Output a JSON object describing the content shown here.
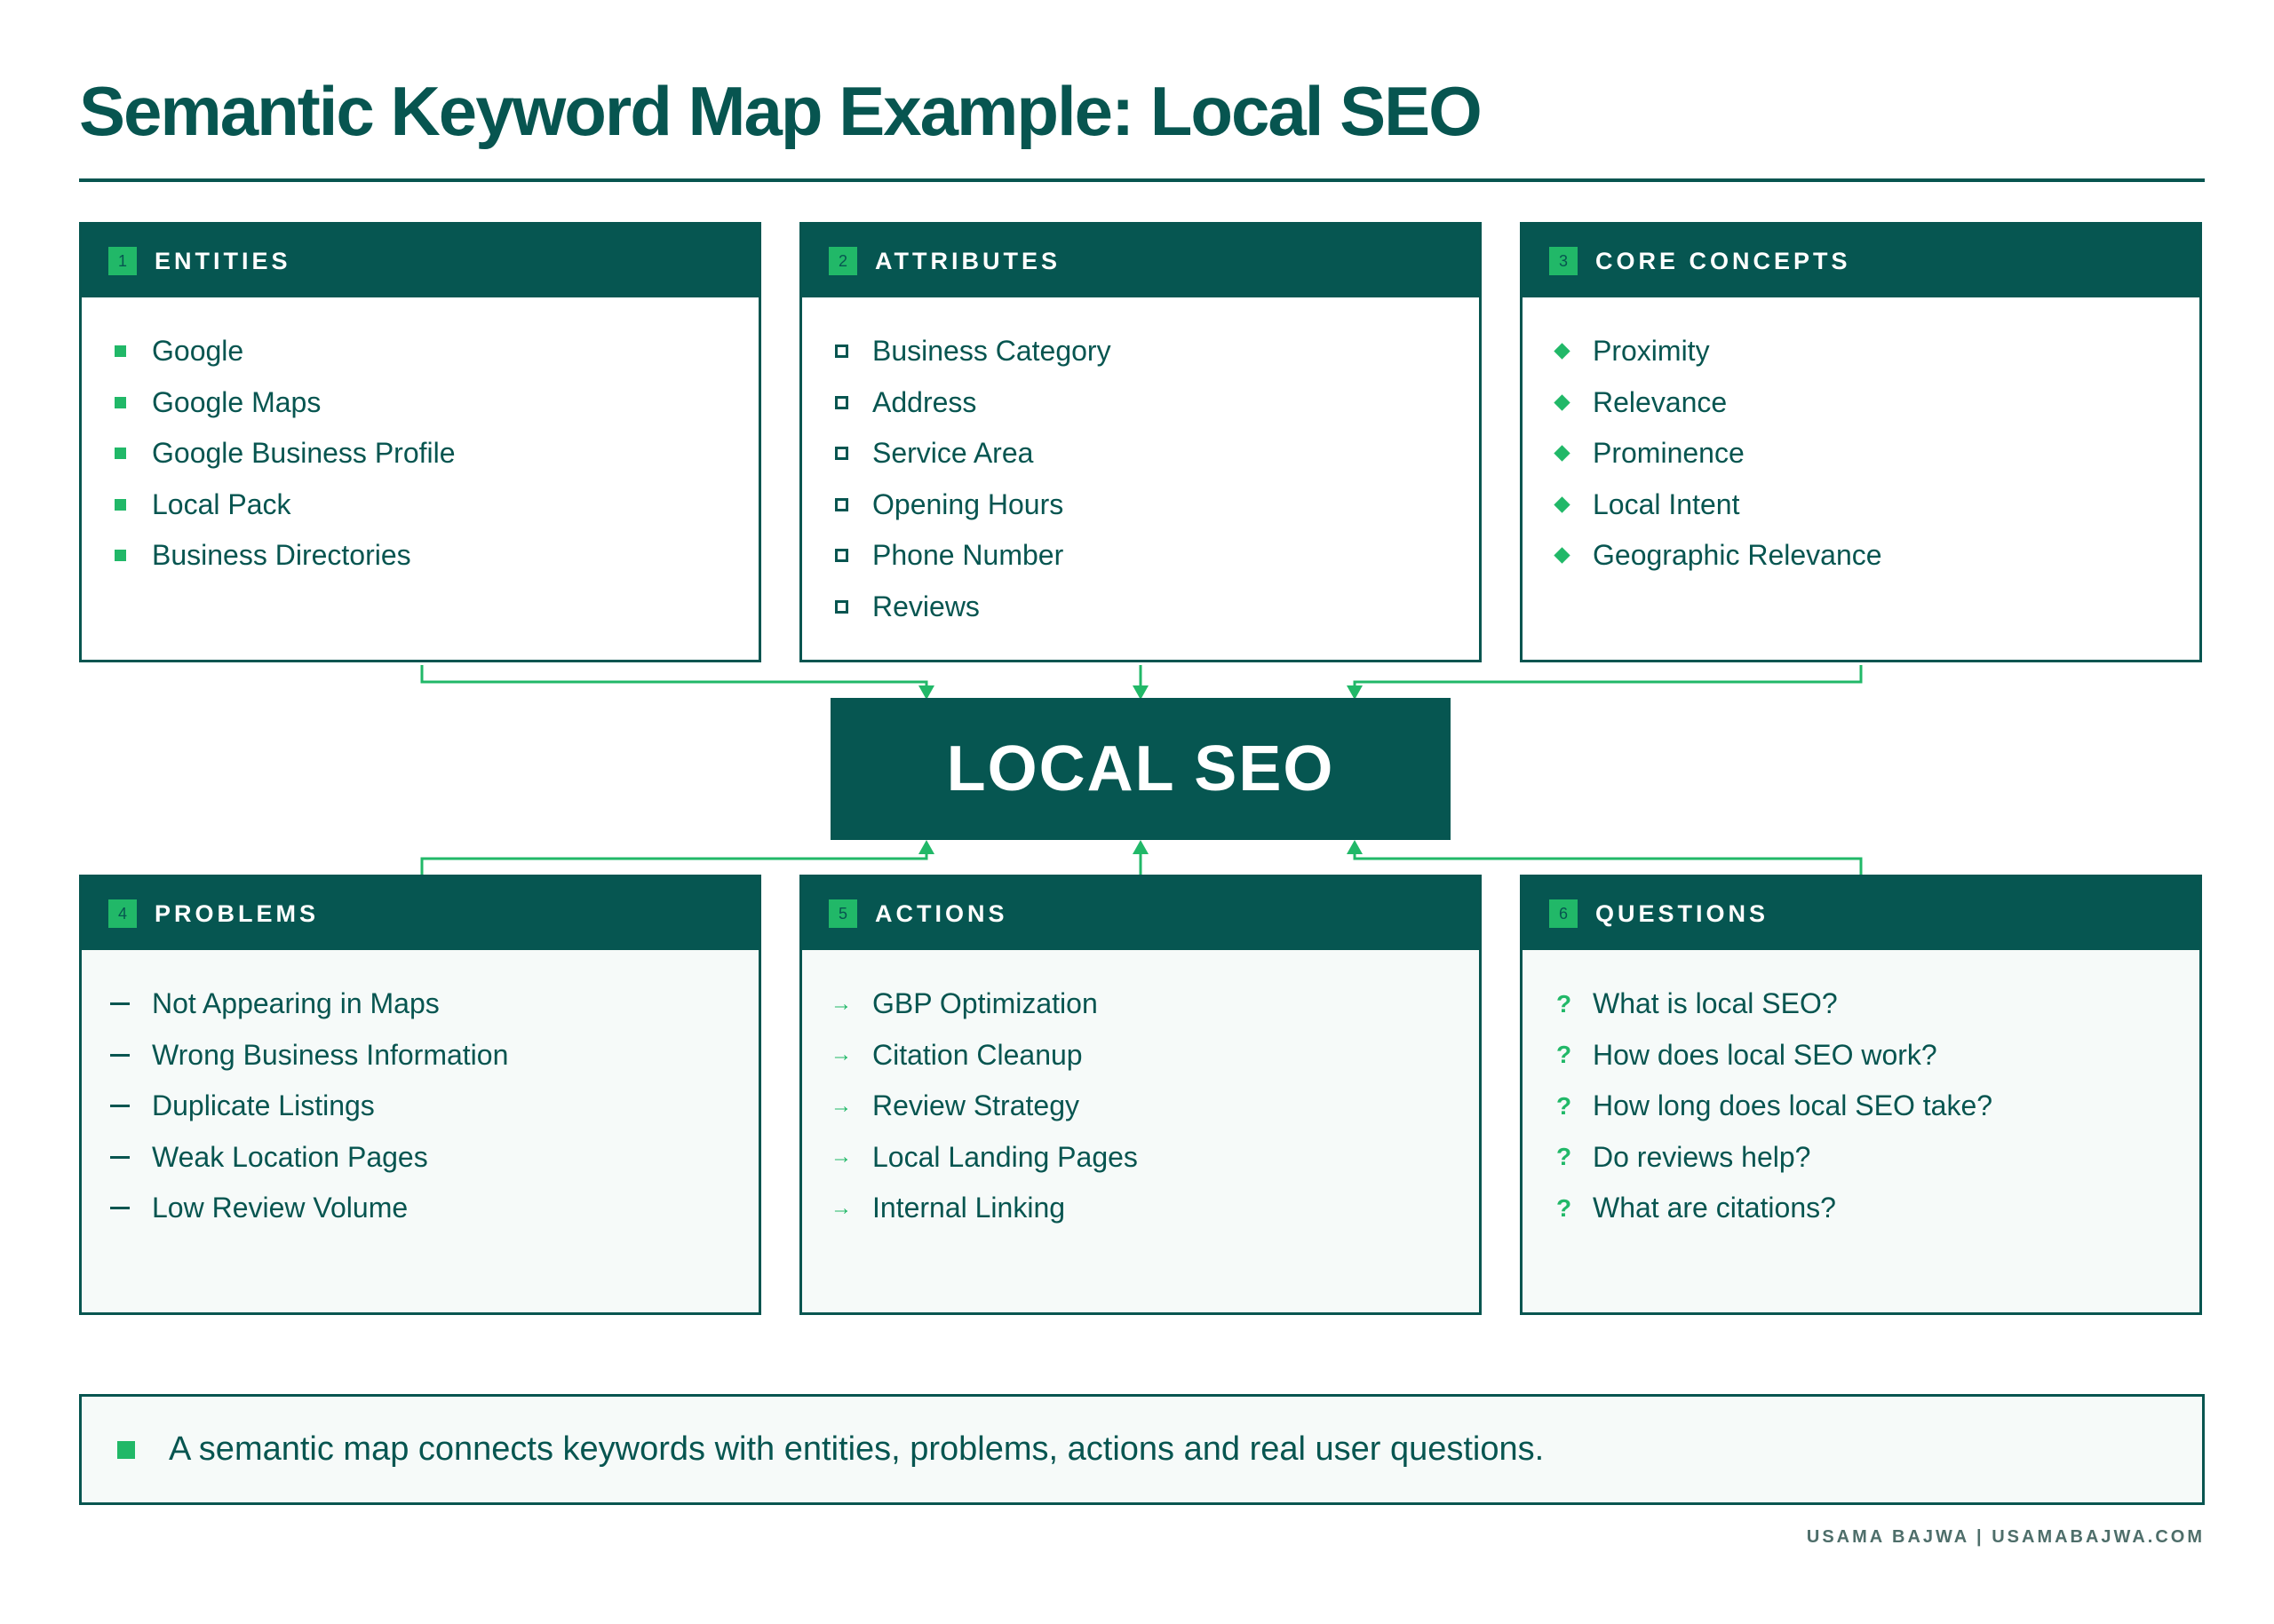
{
  "title": "Semantic Keyword Map Example: Local SEO",
  "center_label": "LOCAL SEO",
  "cards": [
    {
      "number": "1",
      "title": "ENTITIES",
      "marker": "filled-square-bullet",
      "items": [
        "Google",
        "Google Maps",
        "Google Business Profile",
        "Local Pack",
        "Business Directories"
      ]
    },
    {
      "number": "2",
      "title": "ATTRIBUTES",
      "marker": "outlined-square-bullet",
      "items": [
        "Business Category",
        "Address",
        "Service Area",
        "Opening Hours",
        "Phone Number",
        "Reviews"
      ]
    },
    {
      "number": "3",
      "title": "CORE CONCEPTS",
      "marker": "diamond-bullet",
      "items": [
        "Proximity",
        "Relevance",
        "Prominence",
        "Local Intent",
        "Geographic Relevance"
      ]
    },
    {
      "number": "4",
      "title": "PROBLEMS",
      "marker": "dash-bullet",
      "items": [
        "Not Appearing in Maps",
        "Wrong Business Information",
        "Duplicate Listings",
        "Weak Location Pages",
        "Low Review Volume"
      ]
    },
    {
      "number": "5",
      "title": "ACTIONS",
      "marker": "arrow-bullet",
      "items": [
        "GBP Optimization",
        "Citation Cleanup",
        "Review Strategy",
        "Local Landing Pages",
        "Internal Linking"
      ]
    },
    {
      "number": "6",
      "title": "QUESTIONS",
      "marker": "question-mark-bullet",
      "items": [
        "What is local SEO?",
        "How does local SEO work?",
        "How long does local SEO take?",
        "Do reviews help?",
        "What are citations?"
      ]
    }
  ],
  "note": "A semantic map connects keywords with entities, problems, actions and real user questions.",
  "footer": "USAMA BAJWA | USAMABAJWA.COM",
  "colors": {
    "primary": "#065651",
    "accent": "#21b868",
    "text": "#075550"
  }
}
